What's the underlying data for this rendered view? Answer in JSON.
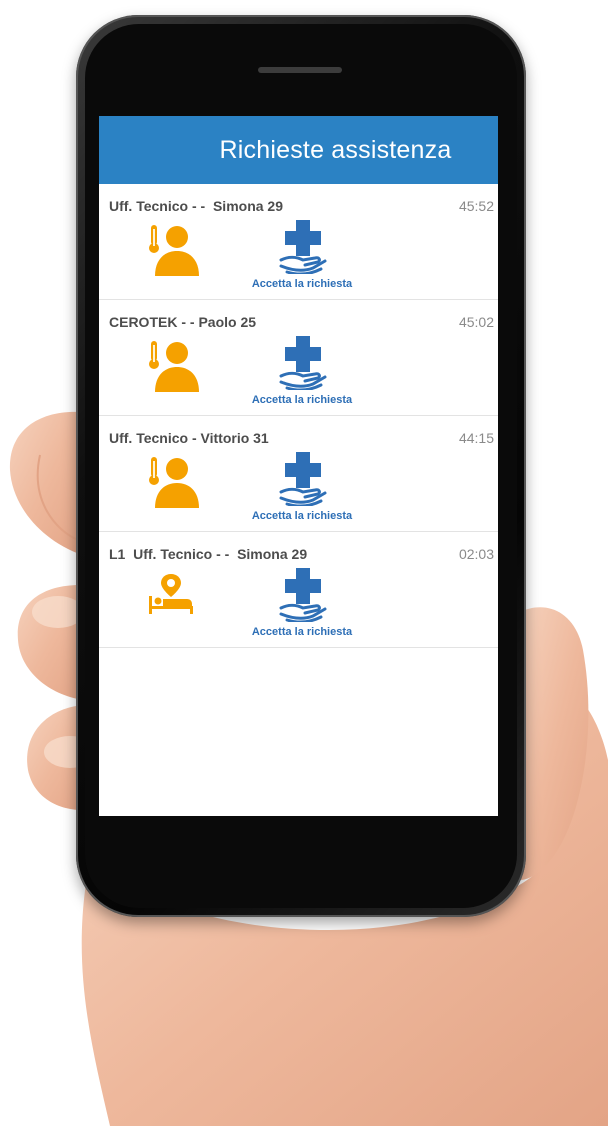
{
  "app": {
    "title": "Richieste assistenza"
  },
  "colors": {
    "header": "#2b82c4",
    "alert_icon": "#f5a100",
    "accept_icon": "#2e6fb6"
  },
  "requests": [
    {
      "name": "Uff. Tecnico - -  Simona 29",
      "time": "45:52",
      "type_icon": "person-temperature-icon",
      "accept_label": "Accetta la richiesta"
    },
    {
      "name": "CEROTEK - - Paolo 25",
      "time": "45:02",
      "type_icon": "person-temperature-icon",
      "accept_label": "Accetta la richiesta"
    },
    {
      "name": "Uff. Tecnico - Vittorio 31",
      "time": "44:15",
      "type_icon": "person-temperature-icon",
      "accept_label": "Accetta la richiesta"
    },
    {
      "name": "L1  Uff. Tecnico - -  Simona 29",
      "time": "02:03",
      "type_icon": "bed-location-icon",
      "accept_label": "Accetta la richiesta"
    }
  ]
}
